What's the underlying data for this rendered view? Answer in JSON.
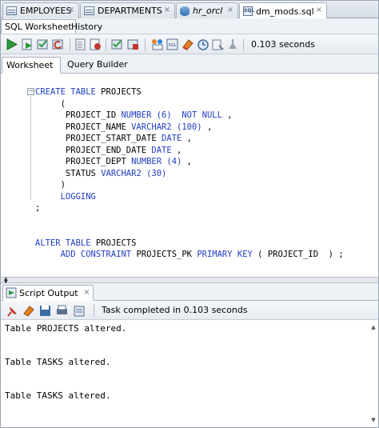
{
  "doc_tabs": [
    {
      "label": "EMPLOYEES",
      "icon": "table-icon"
    },
    {
      "label": "DEPARTMENTS",
      "icon": "table-icon"
    },
    {
      "label": "hr_orcl",
      "icon": "database-connection-icon"
    },
    {
      "label": "dm_mods.sql",
      "icon": "sql-file-icon"
    }
  ],
  "sub_tabs": [
    "SQL Worksheet",
    "History"
  ],
  "toolbar": {
    "elapsed": "0.103 seconds",
    "icons": [
      "run-statement-icon",
      "run-script-icon",
      "commit-icon",
      "rollback-icon",
      "autotrace-icon",
      "explain-plan-icon",
      "sql-tuning-icon",
      "format-sql-icon",
      "eraser-icon",
      "history-icon",
      "unshared-worksheet-icon"
    ]
  },
  "worksheet_tabs": [
    "Worksheet",
    "Query Builder"
  ],
  "editor": {
    "fold_symbol": "−",
    "lines": [
      [
        {
          "t": "CREATE TABLE",
          "c": "kw"
        },
        {
          "t": " PROJECTS",
          "c": ""
        }
      ],
      [
        {
          "t": "     (",
          "c": ""
        }
      ],
      [
        {
          "t": "      PROJECT_ID ",
          "c": ""
        },
        {
          "t": "NUMBER",
          "c": "ty"
        },
        {
          "t": " (6)",
          "c": "nu"
        },
        {
          "t": "  ",
          "c": ""
        },
        {
          "t": "NOT NULL",
          "c": "kw"
        },
        {
          "t": " ,",
          "c": ""
        }
      ],
      [
        {
          "t": "      PROJECT_NAME ",
          "c": ""
        },
        {
          "t": "VARCHAR2",
          "c": "ty"
        },
        {
          "t": " (100)",
          "c": "nu"
        },
        {
          "t": " ,",
          "c": ""
        }
      ],
      [
        {
          "t": "      PROJECT_START_DATE ",
          "c": ""
        },
        {
          "t": "DATE",
          "c": "ty"
        },
        {
          "t": " ,",
          "c": ""
        }
      ],
      [
        {
          "t": "      PROJECT_END_DATE ",
          "c": ""
        },
        {
          "t": "DATE",
          "c": "ty"
        },
        {
          "t": " ,",
          "c": ""
        }
      ],
      [
        {
          "t": "      PROJECT_DEPT ",
          "c": ""
        },
        {
          "t": "NUMBER",
          "c": "ty"
        },
        {
          "t": " (4)",
          "c": "nu"
        },
        {
          "t": " ,",
          "c": ""
        }
      ],
      [
        {
          "t": "      STATUS ",
          "c": ""
        },
        {
          "t": "VARCHAR2",
          "c": "ty"
        },
        {
          "t": " (30)",
          "c": "nu"
        }
      ],
      [
        {
          "t": "     )",
          "c": ""
        }
      ],
      [
        {
          "t": "     LOGGING",
          "c": "kw"
        }
      ],
      [
        {
          "t": ";",
          "c": ""
        }
      ],
      [
        {
          "t": "",
          "c": ""
        }
      ],
      [
        {
          "t": "",
          "c": ""
        }
      ],
      [
        {
          "t": "ALTER TABLE",
          "c": "kw"
        },
        {
          "t": " PROJECTS",
          "c": ""
        }
      ],
      [
        {
          "t": "     ",
          "c": ""
        },
        {
          "t": "ADD CONSTRAINT",
          "c": "kw"
        },
        {
          "t": " PROJECTS_PK ",
          "c": ""
        },
        {
          "t": "PRIMARY KEY",
          "c": "kw"
        },
        {
          "t": " ( PROJECT_ID  ) ;",
          "c": ""
        }
      ]
    ]
  },
  "script_output": {
    "tab_label": "Script Output",
    "status": "Task completed in 0.103 seconds",
    "lines": [
      "Table PROJECTS altered.",
      "",
      "",
      "Table TASKS altered.",
      "",
      "",
      "Table TASKS altered."
    ]
  },
  "colors": {
    "keyword": "#1f3dc2",
    "accent": "#3a6ea5"
  }
}
